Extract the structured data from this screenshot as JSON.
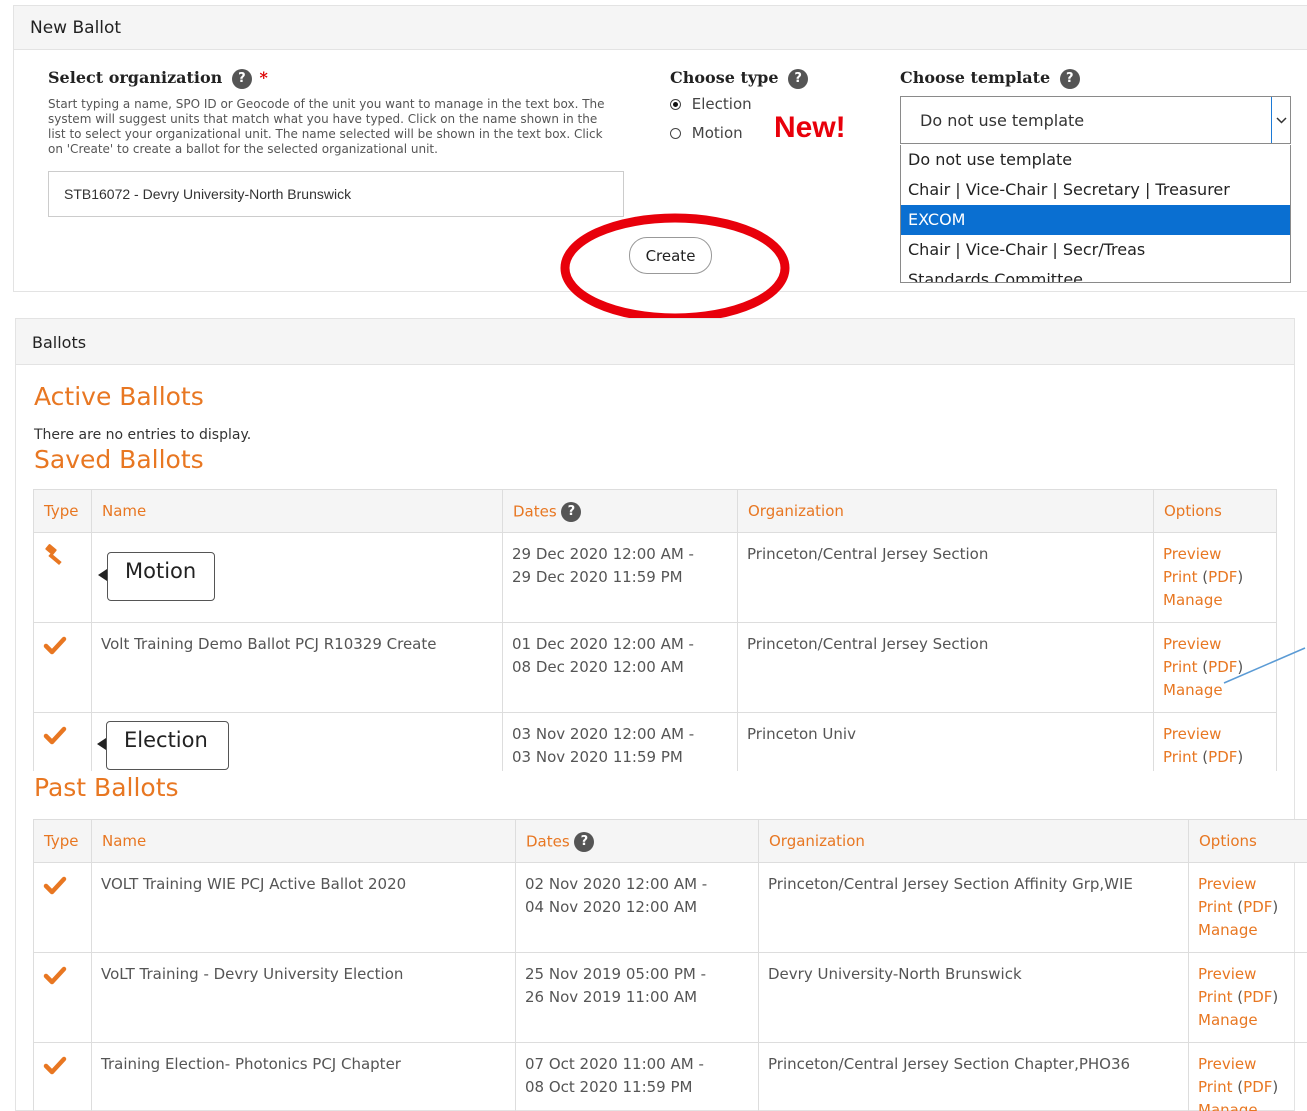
{
  "new_ballot": {
    "title": "New Ballot",
    "select_org_label": "Select organization",
    "required_mark": "*",
    "help_text": "Start typing a name, SPO ID or Geocode of the unit you want to manage in the text box. The system will suggest units that match what you have typed. Click on the name shown in the list to select your organizational unit. The name selected will be shown in the text box. Click on 'Create' to create a ballot for the selected organizational unit.",
    "org_value": "STB16072 - Devry University-North Brunswick",
    "choose_type_label": "Choose type",
    "type_options": [
      "Election",
      "Motion"
    ],
    "selected_type": "Election",
    "new_badge": "New!",
    "choose_template_label": "Choose template",
    "template_value": "Do not use template",
    "template_options": [
      "Do not use template",
      "Chair | Vice-Chair | Secretary | Treasurer",
      "EXCOM",
      "Chair | Vice-Chair | Secr/Treas",
      "Standards Committee"
    ],
    "template_highlighted": "EXCOM",
    "create_button": "Create",
    "help_icon": "?"
  },
  "ballots": {
    "title": "Ballots",
    "active_heading": "Active Ballots",
    "empty_text": "There are no entries to display.",
    "saved_heading": "Saved Ballots",
    "past_heading": "Past Ballots",
    "columns": [
      "Type",
      "Name",
      "Dates",
      "Organization",
      "Options"
    ],
    "options_links": {
      "preview": "Preview",
      "print": "Print",
      "pdf": "PDF",
      "manage": "Manage"
    },
    "saved_rows": [
      {
        "type_icon": "gavel-icon",
        "name": "",
        "dates_start": "29 Dec 2020 12:00 AM -",
        "dates_end": "29 Dec 2020 11:59 PM",
        "org": "Princeton/Central Jersey Section"
      },
      {
        "type_icon": "check-icon",
        "name": "Volt Training Demo Ballot PCJ R10329 Create",
        "dates_start": "01 Dec 2020 12:00 AM -",
        "dates_end": "08 Dec 2020 12:00 AM",
        "org": "Princeton/Central Jersey Section"
      },
      {
        "type_icon": "check-icon",
        "name": "",
        "dates_start": "03 Nov 2020 12:00 AM -",
        "dates_end": "03 Nov 2020 11:59 PM",
        "org": "Princeton Univ"
      }
    ],
    "past_rows": [
      {
        "type_icon": "check-icon",
        "name": "VOLT Training WIE PCJ Active Ballot 2020",
        "dates_start": "02 Nov 2020 12:00 AM -",
        "dates_end": "04 Nov 2020 12:00 AM",
        "org": "Princeton/Central Jersey Section Affinity Grp,WIE"
      },
      {
        "type_icon": "check-icon",
        "name": "VoLT Training - Devry University Election",
        "dates_start": "25 Nov 2019 05:00 PM -",
        "dates_end": "26 Nov 2019 11:00 AM",
        "org": "Devry University-North Brunswick"
      },
      {
        "type_icon": "check-icon",
        "name": "Training Election- Photonics PCJ Chapter",
        "dates_start": "07 Oct 2020 11:00 AM -",
        "dates_end": "08 Oct 2020 11:59 PM",
        "org": "Princeton/Central Jersey Section Chapter,PHO36"
      }
    ]
  },
  "callouts": {
    "motion": "Motion",
    "election": "Election"
  },
  "colors": {
    "accent": "#e87722",
    "highlight": "#0a6fd1",
    "annotation": "#e8000b"
  }
}
